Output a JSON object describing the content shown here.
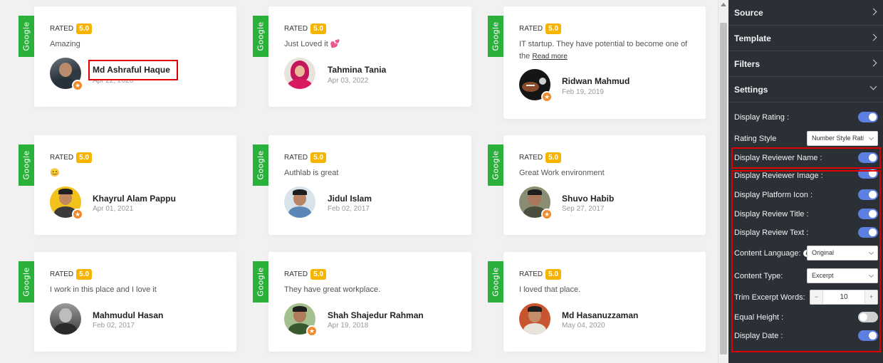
{
  "platform_tag": "Google",
  "rated_label": "RATED",
  "cards": [
    {
      "rating": "5.0",
      "text": "Amazing",
      "name": "Md Ashraful Haque",
      "date": "Apr 22, 2020"
    },
    {
      "rating": "5.0",
      "text": "Just Loved it 💕",
      "name": "Tahmina Tania",
      "date": "Apr 03, 2022"
    },
    {
      "rating": "5.0",
      "text": "IT startup. They have potential to become one of the",
      "read_more": "Read more",
      "name": "Ridwan Mahmud",
      "date": "Feb 19, 2019"
    },
    {
      "rating": "5.0",
      "text": "😊",
      "name": "Khayrul Alam Pappu",
      "date": "Apr 01, 2021"
    },
    {
      "rating": "5.0",
      "text": "Authlab is great",
      "name": "Jidul Islam",
      "date": "Feb 02, 2017"
    },
    {
      "rating": "5.0",
      "text": "Great Work environment",
      "name": "Shuvo Habib",
      "date": "Sep 27, 2017"
    },
    {
      "rating": "5.0",
      "text": "I work in this place and I love it",
      "name": "Mahmudul Hasan",
      "date": "Feb 02, 2017"
    },
    {
      "rating": "5.0",
      "text": "They have great workplace.",
      "name": "Shah Shajedur Rahman",
      "date": "Apr 19, 2018"
    },
    {
      "rating": "5.0",
      "text": "I loved that place.",
      "name": "Md Hasanuzzaman",
      "date": "May 04, 2020"
    }
  ],
  "panel": {
    "sections": {
      "source": "Source",
      "template": "Template",
      "filters": "Filters",
      "settings": "Settings"
    },
    "settings": {
      "display_rating": {
        "label": "Display Rating :",
        "on": true
      },
      "rating_style": {
        "label": "Rating Style",
        "value": "Number Style Rati"
      },
      "display_reviewer_name": {
        "label": "Display Reviewer Name :",
        "on": true
      },
      "display_reviewer_image": {
        "label": "Display Reviewer Image :",
        "on": true
      },
      "display_platform_icon": {
        "label": "Display Platform Icon :",
        "on": true
      },
      "display_review_title": {
        "label": "Display Review Title :",
        "on": true
      },
      "display_review_text": {
        "label": "Display Review Text :",
        "on": true
      },
      "content_language": {
        "label": "Content Language:",
        "value": "Original"
      },
      "content_type": {
        "label": "Content Type:",
        "value": "Excerpt"
      },
      "trim_excerpt_words": {
        "label": "Trim Excerpt Words:",
        "value": "10"
      },
      "equal_height": {
        "label": "Equal Height :",
        "on": false
      },
      "display_date": {
        "label": "Display Date :",
        "on": true
      }
    }
  },
  "colors": {
    "platform_green": "#2ab13b",
    "rating_badge": "#f4b400",
    "toggle_on": "#5d7fe0",
    "panel_bg": "#2b2f36",
    "highlight_red": "#e00000"
  }
}
